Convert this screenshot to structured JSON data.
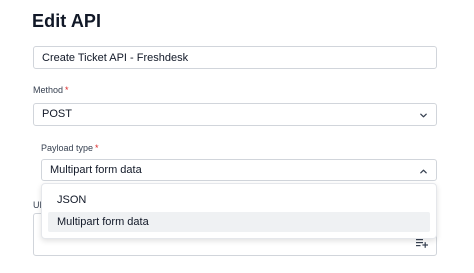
{
  "page": {
    "title": "Edit API"
  },
  "name_field": {
    "value": "Create Ticket API - Freshdesk"
  },
  "method": {
    "label": "Method",
    "required_mark": "*",
    "value": "POST"
  },
  "payload_type": {
    "label": "Payload type",
    "required_mark": "*",
    "value": "Multipart form data",
    "options": [
      "JSON",
      "Multipart form data"
    ],
    "highlighted_option": "Multipart form data"
  },
  "url": {
    "label_partial": "UR"
  },
  "icons": {
    "method_chevron": "chevron-down-icon",
    "payload_chevron": "chevron-up-icon",
    "insert": "playlist-add-icon"
  },
  "colors": {
    "required": "#dc2626",
    "border": "#d1d5db",
    "highlight": "#eff1f3"
  }
}
